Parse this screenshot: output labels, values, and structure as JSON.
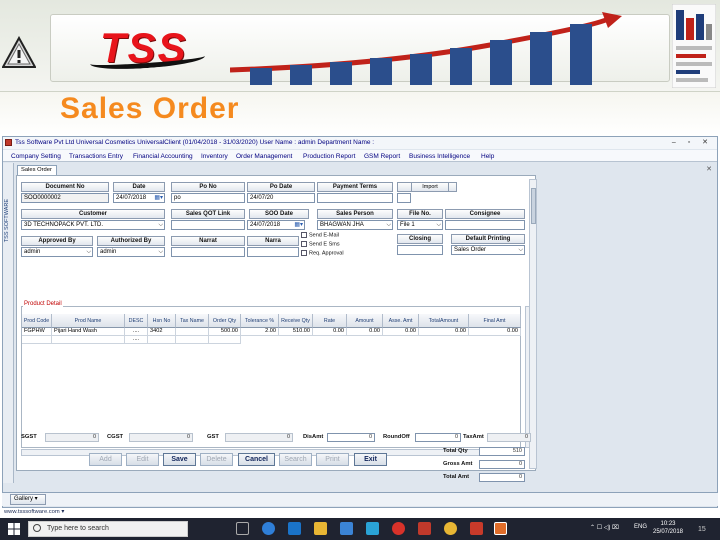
{
  "slide": {
    "logo_text": "TSS",
    "title": "Sales Order",
    "page_number": "15"
  },
  "app": {
    "title_bar": "Tss Software Pvt Ltd   Universal Cosmetics   UniversalClient   (01/04/2018 - 31/03/2020)   User Name : admin   Department Name :",
    "side_label": "TSS SOFTWARE",
    "doc_tab": "Sales Order",
    "menu": [
      "Company Setting",
      "Transactions Entry",
      "Financial Accounting",
      "Inventory",
      "Order Management",
      "Production Report",
      "GSM Report",
      "Business Intelligence",
      "Help"
    ]
  },
  "form": {
    "labels": {
      "document_no": "Document No",
      "date": "Date",
      "po_no": "Po No",
      "po_date": "Po Date",
      "payment_terms": "Payment Terms",
      "import": "Import",
      "customer": "Customer",
      "sales_qot_link": "Sales QOT Link",
      "soo_date": "SOO Date",
      "sales_person": "Sales Person",
      "file_no": "File No.",
      "consignee": "Consignee",
      "approved_by": "Approved By",
      "authorized_by": "Authorized By",
      "narrat": "Narrat",
      "narration2": "Narra",
      "closing": "Closing",
      "default_printing": "Default Printing"
    },
    "values": {
      "document_no": "SOO0000002",
      "date": "24/07/2018",
      "po_no": "po",
      "po_date": "24/07/20",
      "customer": "3D TECHNOPACK PVT. LTD.",
      "soo_date": "24/07/2018",
      "sales_person": "BHAGWAN JHA",
      "file_no": "File 1",
      "approved_by": "admin",
      "authorized_by": "admin",
      "default_printing": "Sales Order"
    },
    "checkboxes": [
      "Send E-Mail",
      "Send E Sms",
      "Req. Approval"
    ]
  },
  "grid": {
    "caption": "Product Detail",
    "columns": [
      "Prod Code",
      "Prod Name",
      "DESC",
      "Hsn No",
      "Tax Name",
      "Order Qty",
      "Tolerance %",
      "Receive Qty",
      "Rate",
      "Amount",
      "Asse. Amt",
      "TotalAmount",
      "Final Amt"
    ],
    "rows": [
      [
        "FGPHW",
        "Pijari Hand Wash",
        "....",
        "3402",
        "",
        "500.00",
        "2.00",
        "510.00",
        "0.00",
        "0.00",
        "0.00",
        "0.00",
        "0.00"
      ],
      [
        "",
        "",
        "....",
        "",
        "",
        "",
        "",
        "",
        "",
        "",
        "",
        "",
        ""
      ]
    ]
  },
  "totals": {
    "sgst_label": "SGST",
    "sgst": "0",
    "cgst_label": "CGST",
    "cgst": "0",
    "gst_label": "GST",
    "gst": "0",
    "disamt_label": "DisAmt",
    "disamt": "0",
    "roundoff_label": "RoundOff",
    "roundoff": "0",
    "taxamt_label": "TaxAmt",
    "taxamt": "0",
    "total_qty_label": "Total Qty",
    "total_qty": "510",
    "gross_amt_label": "Gross Amt",
    "gross_amt": "0",
    "total_amt_label": "Total Amt",
    "total_amt": "0"
  },
  "actions": [
    "Add",
    "Edit",
    "Save",
    "Delete",
    "Cancel",
    "Search",
    "Print",
    "Exit"
  ],
  "footer": {
    "gallery": "Gallery",
    "url": "www.tsssoftware.com"
  },
  "taskbar": {
    "search_placeholder": "Type here to search",
    "lang": "ENG",
    "time": "10:23",
    "date": "25/07/2018"
  }
}
